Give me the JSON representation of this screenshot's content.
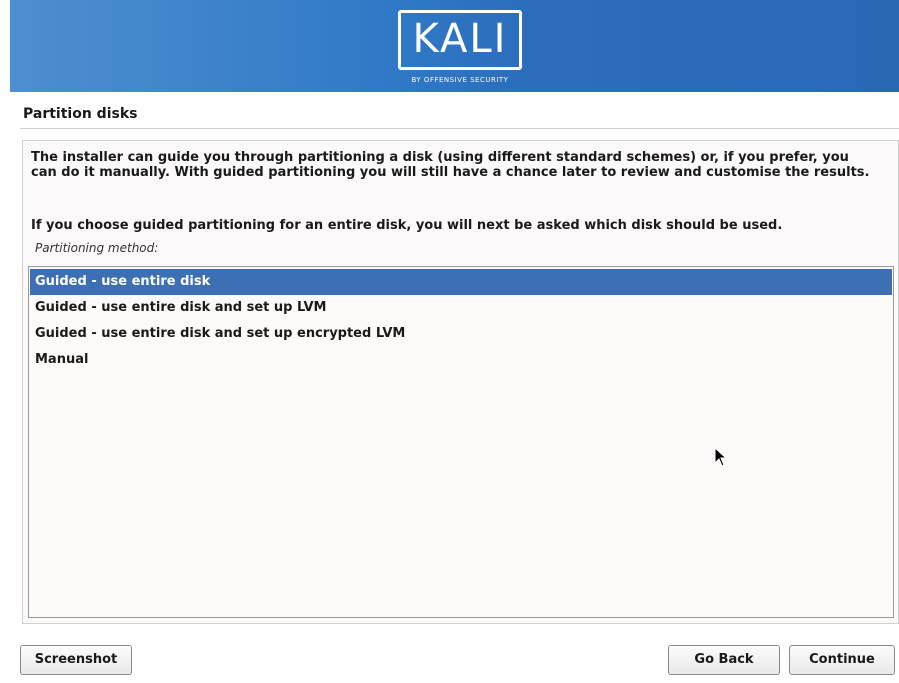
{
  "header": {
    "logo_text": "KALI",
    "logo_subtitle": "BY OFFENSIVE SECURITY",
    "accent_color": "#2f78c6"
  },
  "step_title": "Partition disks",
  "description": {
    "paragraph1": "The installer can guide you through partitioning a disk (using different standard schemes) or, if you prefer, you can do it manually. With guided partitioning you will still have a chance later to review and customise the results.",
    "paragraph2": "If you choose guided partitioning for an entire disk, you will next be asked which disk should be used."
  },
  "partitioning": {
    "label": "Partitioning method:",
    "options": [
      {
        "label": "Guided - use entire disk",
        "selected": true
      },
      {
        "label": "Guided - use entire disk and set up LVM",
        "selected": false
      },
      {
        "label": "Guided - use entire disk and set up encrypted LVM",
        "selected": false
      },
      {
        "label": "Manual",
        "selected": false
      }
    ],
    "selection_color": "#3d6fb5"
  },
  "buttons": {
    "screenshot": "Screenshot",
    "go_back": "Go Back",
    "continue": "Continue"
  },
  "icons": {
    "cursor": "mouse-pointer-icon"
  }
}
